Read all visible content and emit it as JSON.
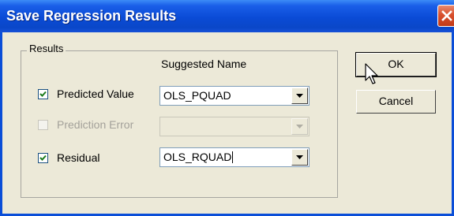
{
  "window": {
    "title": "Save Regression Results"
  },
  "group": {
    "label": "Results",
    "column_header": "Suggested Name"
  },
  "rows": [
    {
      "label": "Predicted Value",
      "checked": true,
      "enabled": true,
      "value": "OLS_PQUAD"
    },
    {
      "label": "Prediction Error",
      "checked": false,
      "enabled": false,
      "value": ""
    },
    {
      "label": "Residual",
      "checked": true,
      "enabled": true,
      "value": "OLS_RQUAD"
    }
  ],
  "buttons": {
    "ok": "OK",
    "cancel": "Cancel"
  },
  "icons": {
    "close": "close-icon",
    "check": "checkmark-icon",
    "dropdown": "chevron-down-icon",
    "cursor": "mouse-pointer-icon"
  },
  "colors": {
    "title_bar": "#0A4BD6",
    "dialog_face": "#ECE9D8",
    "close_button": "#D8502E",
    "disabled_text": "#A3A19A"
  }
}
